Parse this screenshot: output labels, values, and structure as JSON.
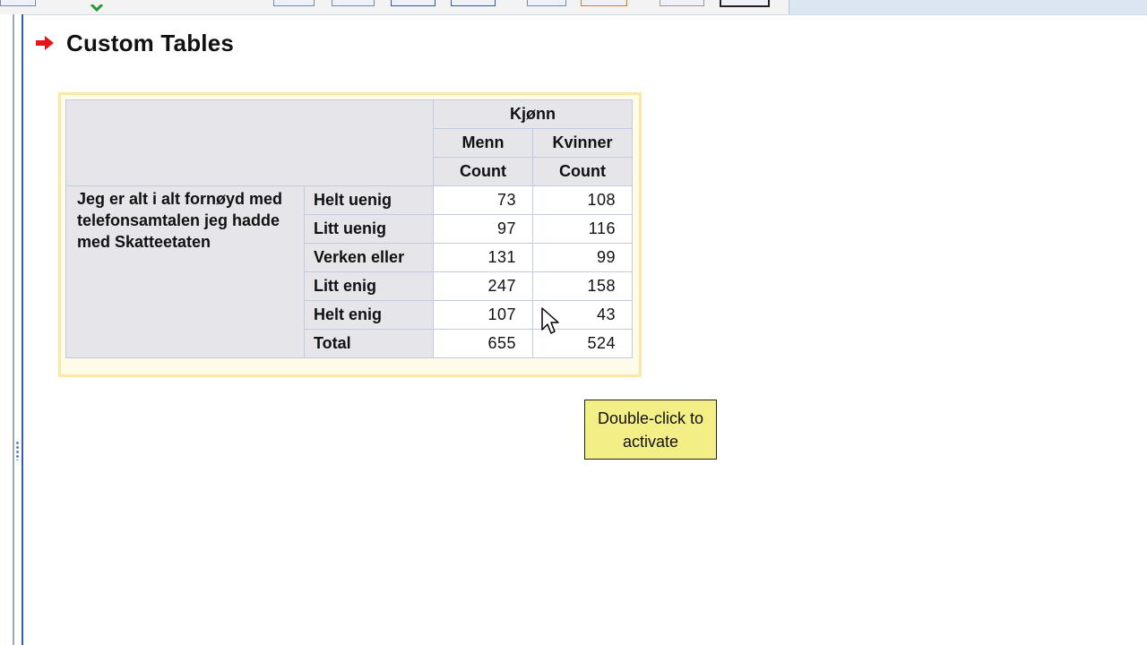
{
  "colors": {
    "accent_arrow": "#e4161c",
    "selection_border": "#fbe7a8",
    "tooltip_bg": "#f4ee86",
    "header_bg": "#e6e6ea",
    "grid_line": "#bfcbe0"
  },
  "icons": {
    "heading": "red-arrow-right-icon",
    "pointer": "mouse-cursor-icon"
  },
  "page": {
    "title": "Custom Tables"
  },
  "table": {
    "column_variable": "Kjønn",
    "columns": [
      {
        "label": "Menn",
        "statistic": "Count"
      },
      {
        "label": "Kvinner",
        "statistic": "Count"
      }
    ],
    "row_variable": "Jeg er alt i alt fornøyd med telefonsamtalen jeg hadde med Skatteetaten",
    "rows": [
      {
        "label": "Helt uenig",
        "values": [
          "73",
          "108"
        ]
      },
      {
        "label": "Litt uenig",
        "values": [
          "97",
          "116"
        ]
      },
      {
        "label": "Verken eller",
        "values": [
          "131",
          "99"
        ]
      },
      {
        "label": "Litt enig",
        "values": [
          "247",
          "158"
        ]
      },
      {
        "label": "Helt enig",
        "values": [
          "107",
          "43"
        ]
      },
      {
        "label": "Total",
        "values": [
          "655",
          "524"
        ]
      }
    ]
  },
  "tooltip": {
    "text": "Double-click to activate"
  }
}
